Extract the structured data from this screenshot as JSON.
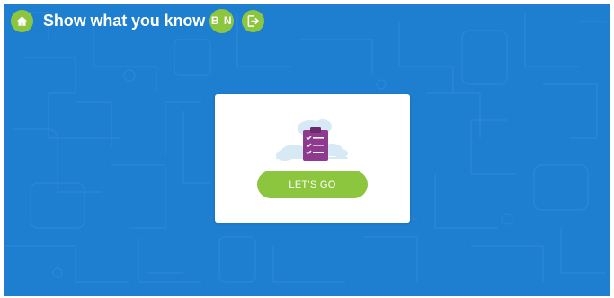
{
  "app": {
    "title": "Show what you know"
  },
  "user": {
    "initials": "B N"
  },
  "icons": {
    "home": "home-icon",
    "logout": "logout-icon",
    "illustration": "clipboard-checklist-icon"
  },
  "card": {
    "button_label": "LET'S GO"
  },
  "colors": {
    "background": "#1e7fd0",
    "accent": "#8cc63f",
    "clipboard": "#8e3a8f",
    "card": "#ffffff"
  }
}
